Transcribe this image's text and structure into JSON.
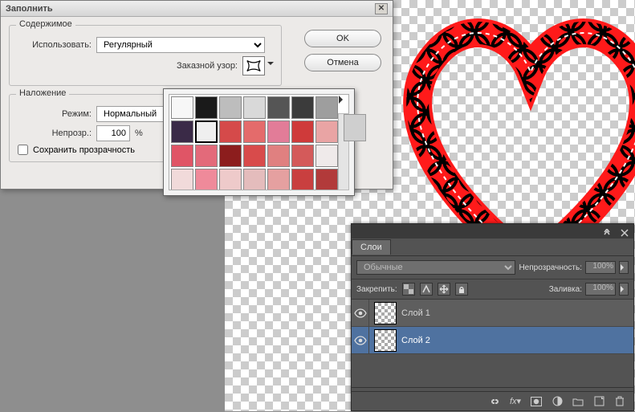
{
  "fill_dialog": {
    "title": "Заполнить",
    "content_legend": "Содержимое",
    "use_label": "Использовать:",
    "use_value": "Регулярный",
    "pattern_label": "Заказной узор:",
    "blend_legend": "Наложение",
    "mode_label": "Режим:",
    "mode_value": "Нормальный",
    "opacity_label": "Непрозр.:",
    "opacity_value": "100",
    "opacity_unit": "%",
    "preserve_label": "Сохранить прозрачность",
    "ok": "OK",
    "cancel": "Отмена"
  },
  "pattern_popup": {
    "selected_index": 8,
    "swatch_colors": [
      "#f7f7f7",
      "#1a1a1a",
      "#bdbdbd",
      "#d9d9d9",
      "#555555",
      "#3b3b3b",
      "#9e9e9e",
      "#3a2a47",
      "#efefef",
      "#d54a4a",
      "#e46b6b",
      "#e27c98",
      "#cf3a3a",
      "#e9a4a4",
      "#e05566",
      "#e36a7a",
      "#8c1d1d",
      "#d84b4b",
      "#e08080",
      "#d45a5a",
      "#efeaea",
      "#f1dada",
      "#ef8a9a",
      "#eecaca",
      "#e4bcbc",
      "#e5a0a0",
      "#c93f3f",
      "#b23a3a"
    ]
  },
  "layers": {
    "tab": "Слои",
    "blend_value": "Обычные",
    "opacity_label": "Непрозрачность:",
    "opacity_value": "100%",
    "lock_label": "Закрепить:",
    "fill_label": "Заливка:",
    "fill_value": "100%",
    "rows": [
      {
        "name": "Слой 1",
        "selected": false
      },
      {
        "name": "Слой 2",
        "selected": true
      }
    ]
  }
}
